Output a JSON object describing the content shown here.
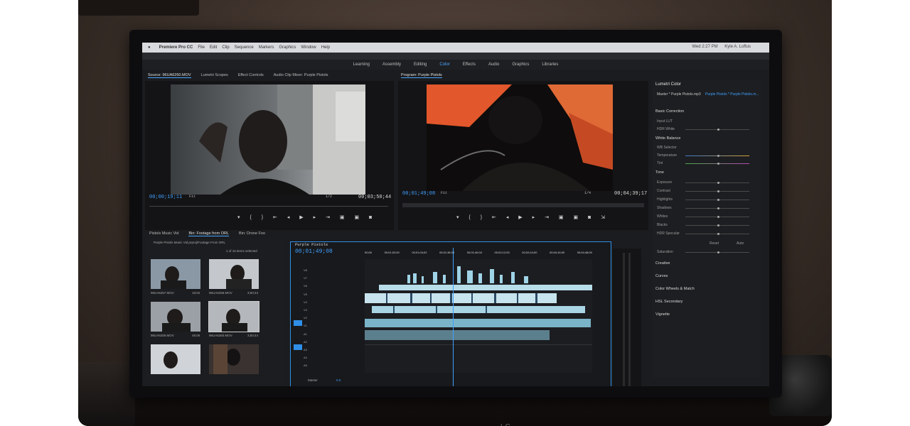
{
  "menubar": {
    "app_name": "Premiere Pro CC",
    "items": [
      "File",
      "Edit",
      "Clip",
      "Sequence",
      "Markers",
      "Graphics",
      "Window",
      "Help"
    ],
    "clock": "Wed 2:27 PM",
    "user": "Kyle A. Loftus"
  },
  "workspaces": [
    "Learning",
    "Assembly",
    "Editing",
    "Color",
    "Effects",
    "Audio",
    "Graphics",
    "Libraries"
  ],
  "active_workspace": "Color",
  "source_panel": {
    "tabs": [
      "Source: 96UA6260.MOV",
      "Lumetri Scopes",
      "Effect Controls",
      "Audio Clip Mixer: Purple Pistols"
    ],
    "timecode": "00;00;19;11",
    "duration": "00;03;50;44",
    "zoom": "Fit",
    "ratio": "1/2"
  },
  "program_panel": {
    "title": "Program: Purple Pistols",
    "timecode": "00;01;49;08",
    "duration": "00;04;39;17",
    "zoom": "Fit",
    "ratio": "1/4"
  },
  "lumetri": {
    "title": "Lumetri Color",
    "master": "Master * Purple Pistols.mp3",
    "sequence": "Purple Pistols * Purple Pistols.m...",
    "sections": {
      "basic": "Basic Correction",
      "wb": "White Balance",
      "tone": "Tone",
      "creative": "Creative",
      "curves": "Curves",
      "wheels": "Color Wheels & Match",
      "hsl": "HSL Secondary",
      "vignette": "Vignette"
    },
    "rows_basic": [
      "Input LUT",
      "HDR White"
    ],
    "rows_wb": [
      "WB Selector",
      "Temperature",
      "Tint"
    ],
    "rows_tone": [
      "Exposure",
      "Contrast",
      "Highlights",
      "Shadows",
      "Whites",
      "Blacks",
      "HDR Specular"
    ],
    "reset_label": "Reset",
    "auto_label": "Auto",
    "saturation_label": "Saturation"
  },
  "project": {
    "tabs": [
      "Pistols Music Vid",
      "Bin: Footage from ORL",
      "Bin: Drone Foo"
    ],
    "path": "Purple Pistols Music Vid.prproj\\Footage From ORL",
    "selected": "1 of 15 items selected",
    "thumbs": [
      {
        "name": "96UA6257.MOV",
        "dur": "19;02"
      },
      {
        "name": "96UA6258.MOV",
        "dur": "3;50;43"
      },
      {
        "name": "96UA6259.MOV",
        "dur": "49;06"
      },
      {
        "name": "96UA6260.MOV",
        "dur": "3;50;44"
      }
    ]
  },
  "timeline": {
    "title": "Purple Pistols",
    "timecode": "00;01;49;08",
    "ruler": [
      "00;00",
      "00;01;02;00",
      "00;01;04;02",
      "00;01;36;04",
      "00;01;40;04",
      "00;02;12;00",
      "00;02;44;00",
      "00;04;16;00",
      "00;04;48;00"
    ],
    "tracks_video": [
      "V8",
      "V7",
      "V6",
      "V5",
      "V4",
      "V3",
      "V2",
      "V1"
    ],
    "tracks_audio": [
      "A1",
      "A2",
      "A3",
      "A4",
      "A5"
    ],
    "master_label": "Master",
    "master_value": "0.0"
  },
  "brand": "LG"
}
